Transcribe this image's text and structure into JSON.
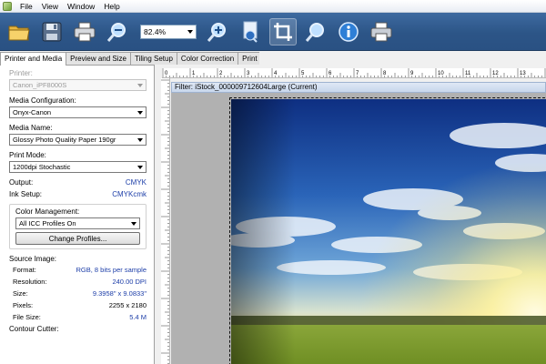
{
  "menu": {
    "items": [
      "File",
      "View",
      "Window",
      "Help"
    ]
  },
  "toolbar": {
    "zoom_value": "82.4%",
    "buttons": [
      "open-folder-icon",
      "save-icon",
      "print-icon",
      "zoom-out-icon",
      "zoom-in-icon",
      "page-preview-icon",
      "crop-icon",
      "zoom-fit-icon",
      "info-icon",
      "printer-settings-icon"
    ]
  },
  "tabs": [
    {
      "label": "Printer and Media",
      "active": true
    },
    {
      "label": "Preview and Size",
      "active": false
    },
    {
      "label": "Tiling Setup",
      "active": false
    },
    {
      "label": "Color Correction",
      "active": false
    },
    {
      "label": "Print",
      "active": false
    }
  ],
  "panel": {
    "printer_label": "Printer:",
    "printer_value": "Canon_iPF8000S",
    "media_config_label": "Media Configuration:",
    "media_config_value": "Onyx-Canon",
    "media_name_label": "Media Name:",
    "media_name_value": "Glossy Photo Quality Paper 190gr",
    "print_mode_label": "Print Mode:",
    "print_mode_value": "1200dpi Stochastic",
    "output_label": "Output:",
    "output_value": "CMYK",
    "ink_setup_label": "Ink Setup:",
    "ink_setup_value": "CMYKcmk",
    "color_mgmt_label": "Color Management:",
    "color_mgmt_value": "All ICC Profiles On",
    "change_profiles_label": "Change Profiles...",
    "source_image_label": "Source Image:",
    "format_label": "Format:",
    "format_value": "RGB, 8 bits per sample",
    "resolution_label": "Resolution:",
    "resolution_value": "240.00 DPI",
    "size_label": "Size:",
    "size_value": "9.3958\" x 9.0833\"",
    "pixels_label": "Pixels:",
    "pixels_value": "2255 x 2180",
    "file_size_label": "File Size:",
    "file_size_value": "5.4 M",
    "contour_cutter_label": "Contour Cutter:"
  },
  "ruler": {
    "labels": [
      "0",
      "1",
      "2",
      "3",
      "4",
      "5",
      "6",
      "7",
      "8",
      "9",
      "10",
      "11",
      "12",
      "13",
      "14",
      "15"
    ]
  },
  "filter_bar": {
    "text": "Filter: iStock_000009712604Large (Current)"
  },
  "colors": {
    "toolbar_bg": "#2c5587",
    "link_blue": "#1d3ea8",
    "canvas_gray": "#b1b1b1"
  }
}
